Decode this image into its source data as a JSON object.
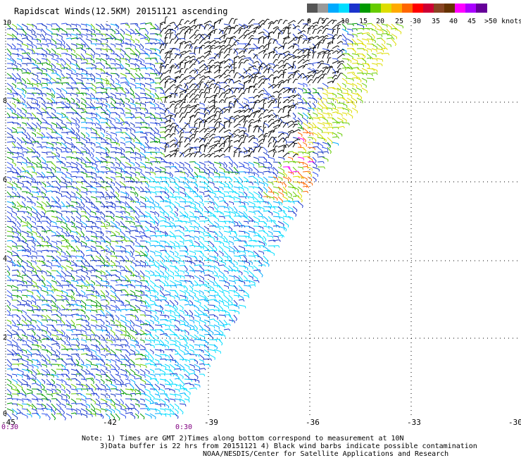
{
  "title": "Rapidscat Winds(12.5KM) 20151121 ascending",
  "legend": {
    "colors": [
      "#555555",
      "#999999",
      "#00aaff",
      "#00ddff",
      "#1a33cc",
      "#009900",
      "#66cc00",
      "#dddd00",
      "#ffaa00",
      "#ff6600",
      "#ff0000",
      "#cc0033",
      "#884422",
      "#663300",
      "#ff00ff",
      "#aa00ff",
      "#660099"
    ],
    "labels": [
      "0",
      "5",
      "10",
      "15",
      "20",
      "25",
      "30",
      "35",
      "40",
      "45",
      ">50 knots"
    ]
  },
  "axes": {
    "lon_ticks": [
      "-45",
      "-42",
      "-39",
      "-36",
      "-33",
      "-30"
    ],
    "lat_ticks": [
      "10",
      "8",
      "6",
      "4",
      "2",
      "0"
    ],
    "time_labels": [
      "0:30",
      "0:30"
    ]
  },
  "notes": {
    "line1": "Note: 1) Times are GMT 2)Times along bottom correspond to measurement at 10N",
    "line2": "3)Data buffer is 22 hrs from 20151121 4) Black wind barbs indicate possible contamination",
    "line3": "NOAA/NESDIS/Center for Satellite Applications and Research"
  }
}
